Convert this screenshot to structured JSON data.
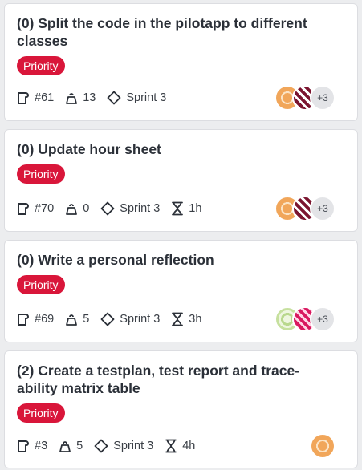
{
  "cards": [
    {
      "title": "(0) Split the code in the pilotapp to different classes",
      "badge": "Priority",
      "id": "#61",
      "points": "13",
      "sprint": "Sprint 3",
      "time": "",
      "extra_count": "+3"
    },
    {
      "title": "(0) Update hour sheet",
      "badge": "Priority",
      "id": "#70",
      "points": "0",
      "sprint": "Sprint 3",
      "time": "1h",
      "extra_count": "+3"
    },
    {
      "title": "(0) Write a personal reflection",
      "badge": "Priority",
      "id": "#69",
      "points": "5",
      "sprint": "Sprint 3",
      "time": "3h",
      "extra_count": "+3"
    },
    {
      "title": "(2) Create a testplan, test report and trace-ability matrix table",
      "badge": "Priority",
      "id": "#3",
      "points": "5",
      "sprint": "Sprint 3",
      "time": "4h",
      "extra_count": ""
    }
  ],
  "colors": {
    "badge": "#d9163a",
    "card": "#ffffff",
    "background": "#ecedef"
  },
  "icons": {
    "id": "ticket-icon",
    "points": "weight-icon",
    "sprint": "diamond-icon",
    "time": "hourglass-icon"
  }
}
